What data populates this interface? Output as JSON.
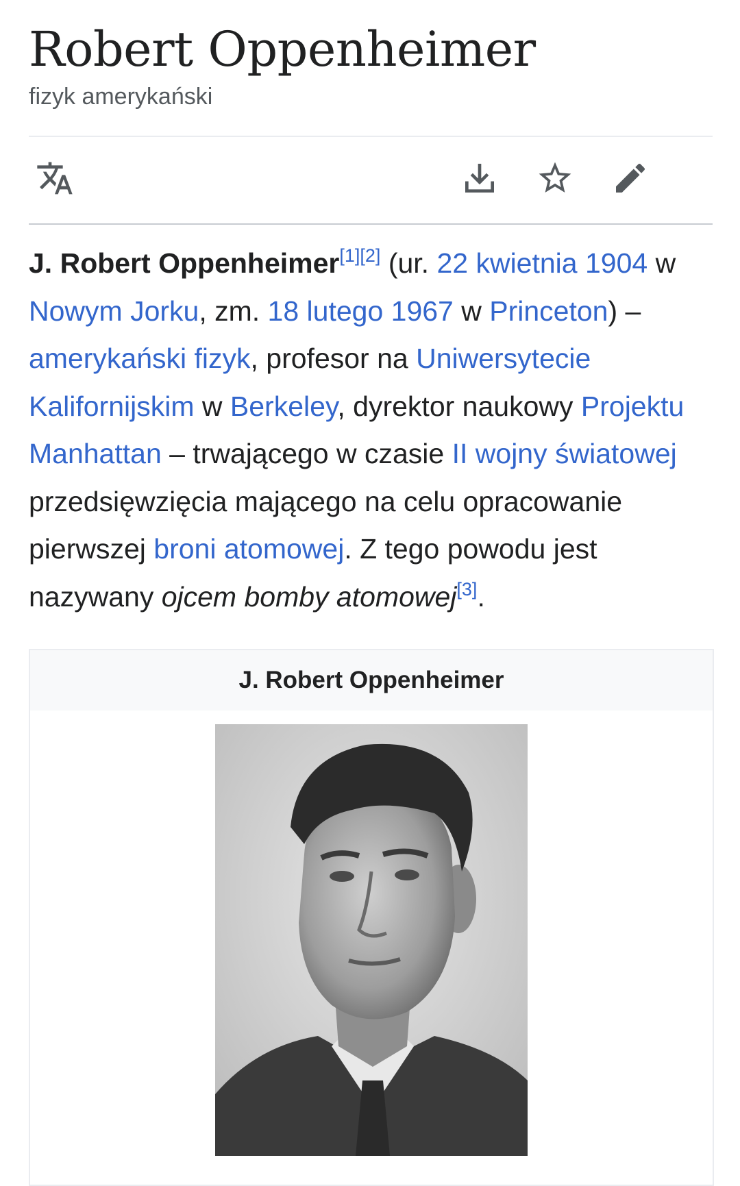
{
  "article": {
    "title": "Robert Oppenheimer",
    "description": "fizyk amerykański"
  },
  "toolbar": {
    "language_icon": "translate-icon",
    "download_icon": "download-icon",
    "watch_icon": "star-icon",
    "edit_icon": "pencil-icon"
  },
  "lead": {
    "subject_name": "J. Robert Oppenheimer",
    "ref1": "[1]",
    "ref2": "[2]",
    "t1": " (ur. ",
    "link_birth_date": "22 kwietnia 1904",
    "t2": " w ",
    "link_birth_place": "Nowym Jorku",
    "t3": ", zm. ",
    "link_death_date": "18 lutego 1967",
    "t4": " w ",
    "link_death_place": "Princeton",
    "t5": ") – ",
    "link_profession": "amerykański fizyk",
    "t6": ", profesor na ",
    "link_university": "Uniwersytecie Kalifornijskim",
    "t7": " w ",
    "link_berkeley": "Berkeley",
    "t8": ", dyrektor naukowy ",
    "link_project": "Projektu Manhattan",
    "t9": " – trwającego w czasie ",
    "link_ww2": "II wojny światowej",
    "t10": " przedsięwzięcia mającego na celu opracowanie pierwszej ",
    "link_atomic_weapon": "broni atomowej",
    "t11": ". Z tego powodu jest nazywany ",
    "italic_phrase": "ojcem bomby atomowej",
    "ref3": "[3]",
    "t12": "."
  },
  "infobox": {
    "caption": "J. Robert Oppenheimer"
  },
  "colors": {
    "link": "#3366cc",
    "text": "#202122",
    "subtle": "#54595d",
    "infobox_header": "#f8f9fa"
  }
}
